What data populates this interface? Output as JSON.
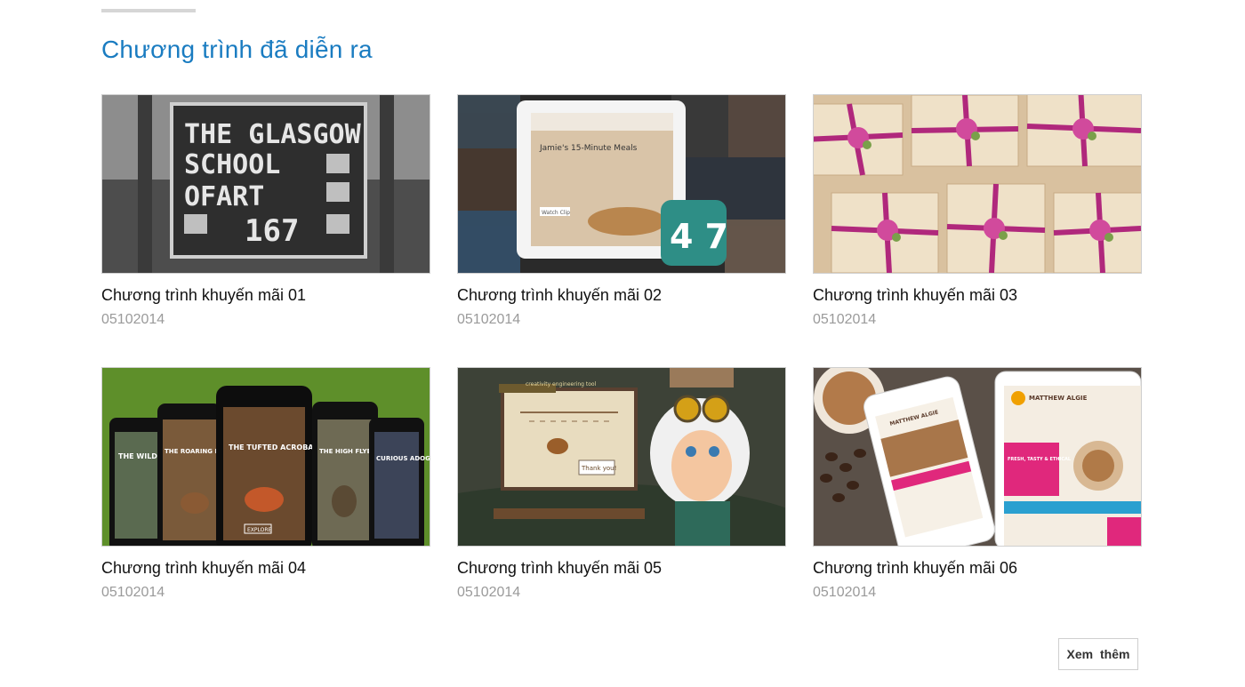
{
  "section": {
    "title": "Chương trình đã diễn ra"
  },
  "cards": [
    {
      "title": "Chương trình khuyến mãi 01",
      "date": "05102014",
      "image": {
        "lines": [
          "THE GLASGOW",
          "SCHOOL",
          "OFART",
          "167"
        ]
      }
    },
    {
      "title": "Chương trình khuyến mãi 02",
      "date": "05102014",
      "image": {
        "heading": "Jamie's 15-Minute Meals",
        "button": "Watch Clip",
        "logo": "4 7"
      }
    },
    {
      "title": "Chương trình khuyến mãi 03",
      "date": "05102014",
      "image": {}
    },
    {
      "title": "Chương trình khuyến mãi 04",
      "date": "05102014",
      "image": {
        "phones": [
          "THE WILD DIVE",
          "THE ROARING MONARCH",
          "THE TUFTED ACROBAT",
          "THE HIGH FLYER",
          "CURIOUS ADOG"
        ],
        "button": "EXPLORE"
      }
    },
    {
      "title": "Chương trình khuyến mãi 05",
      "date": "05102014",
      "image": {
        "tag": "creativity engineering tool",
        "bubble": "Thank you!"
      }
    },
    {
      "title": "Chương trình khuyến mãi 06",
      "date": "05102014",
      "image": {
        "brand": "MATTHEW ALGIE",
        "banner": "FRESH, TASTY & ETHICAL"
      }
    }
  ],
  "more_button": {
    "label": "Xem thêm"
  }
}
